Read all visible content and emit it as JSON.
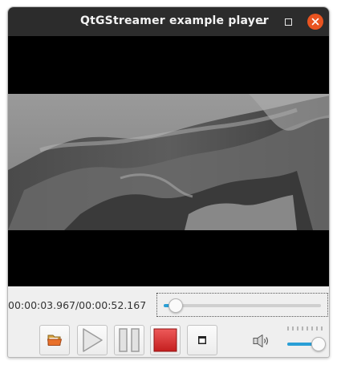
{
  "window": {
    "title": "QtGStreamer example player"
  },
  "titlebar_buttons": {
    "minimize_icon": "minimize-icon",
    "maximize_icon": "maximize-icon",
    "close_icon": "close-icon",
    "close_color": "#e95420"
  },
  "video": {
    "description_hidden": true
  },
  "playback": {
    "timecode": "00:00:03.967/00:00:52.167",
    "position_fraction": 0.076
  },
  "toolbar": {
    "open_icon": "folder-open-icon",
    "play_icon": "play-icon",
    "pause_icon": "pause-icon",
    "stop_icon": "stop-icon",
    "fullscreen_icon": "fullscreen-icon",
    "stop_color": "#d42b2b"
  },
  "volume": {
    "icon": "speaker-icon",
    "level_fraction": 0.88
  },
  "colors": {
    "accent": "#2a9fd6",
    "titlebar": "#2c2c2c"
  }
}
